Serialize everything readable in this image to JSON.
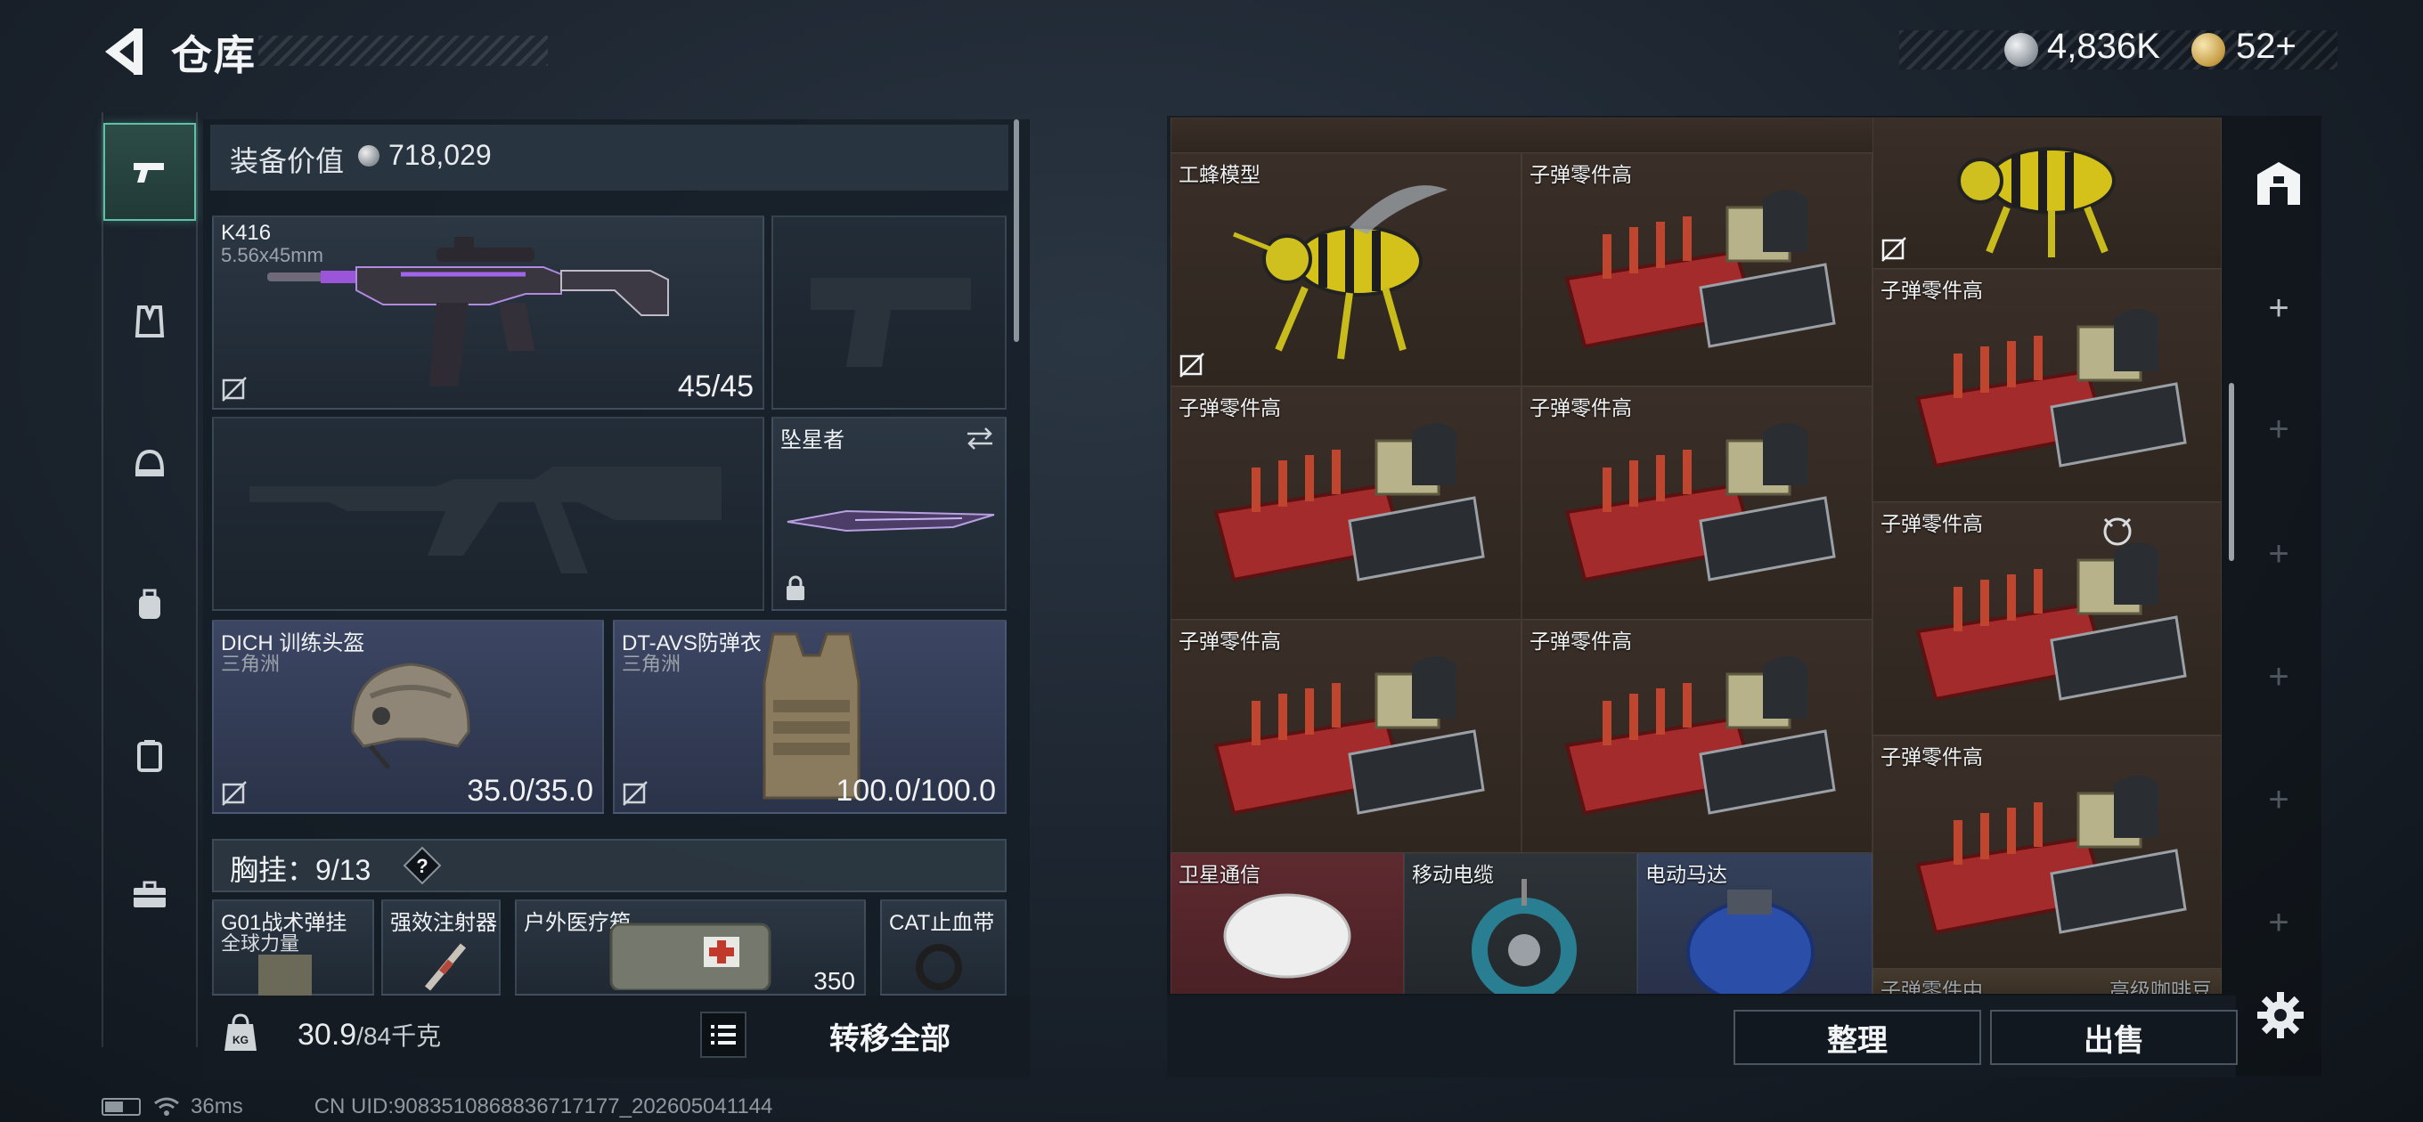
{
  "header": {
    "title": "仓库",
    "money": "4,836K",
    "gold": "52+"
  },
  "rail": {
    "items": [
      {
        "icon": "pistol-icon",
        "active": true
      },
      {
        "icon": "vest-icon",
        "active": false
      },
      {
        "icon": "helmet-icon",
        "active": false
      },
      {
        "icon": "backpack-icon",
        "active": false
      },
      {
        "icon": "case-icon",
        "active": false
      },
      {
        "icon": "briefcase-icon",
        "active": false
      }
    ]
  },
  "loadout": {
    "value_label": "装备价值",
    "value": "718,029",
    "primary": {
      "name": "K416",
      "caliber": "5.56x45mm",
      "ammo": "45/45"
    },
    "melee": {
      "name": "坠星者"
    },
    "helmet": {
      "name": "DICH 训练头盔",
      "sub": "三角洲",
      "durability": "35.0/35.0"
    },
    "armor": {
      "name": "DT-AVS防弹衣",
      "sub": "三角洲",
      "durability": "100.0/100.0"
    },
    "rig": {
      "label": "胸挂：",
      "count": "9/13",
      "help": "?"
    },
    "rig_items": [
      {
        "name": "G01战术弹挂",
        "sub": "全球力量"
      },
      {
        "name": "强效注射器",
        "sub": ""
      },
      {
        "name": "户外医疗箱",
        "sub": ""
      },
      {
        "name": "CAT止血带",
        "sub": ""
      }
    ],
    "rig_med_count": "350",
    "weight": "30.9",
    "weight_max": "/84千克",
    "transfer_all": "转移全部"
  },
  "stash": {
    "cells": [
      {
        "label": "工蜂模型"
      },
      {
        "label": "子弹零件高"
      },
      {
        "label": "子弹零件高"
      },
      {
        "label": "子弹零件高"
      },
      {
        "label": "子弹零件高"
      },
      {
        "label": "子弹零件高"
      },
      {
        "label": "子弹零件高"
      },
      {
        "label": "子弹零件高"
      },
      {
        "label": "子弹零件高"
      },
      {
        "label": "卫星通信"
      },
      {
        "label": "移动电缆"
      },
      {
        "label": "电动马达"
      },
      {
        "label": "子弹零件中"
      },
      {
        "label": "高级咖啡豆"
      }
    ],
    "sort_label": "整理",
    "sell_label": "出售"
  },
  "status": {
    "ping": "36ms",
    "uid": "CN UID:9083510868836717177_202605041144"
  },
  "colors": {
    "accent": "#5ec3a6",
    "panel": "#1a222c",
    "stash_cell": "#3a2f28"
  }
}
